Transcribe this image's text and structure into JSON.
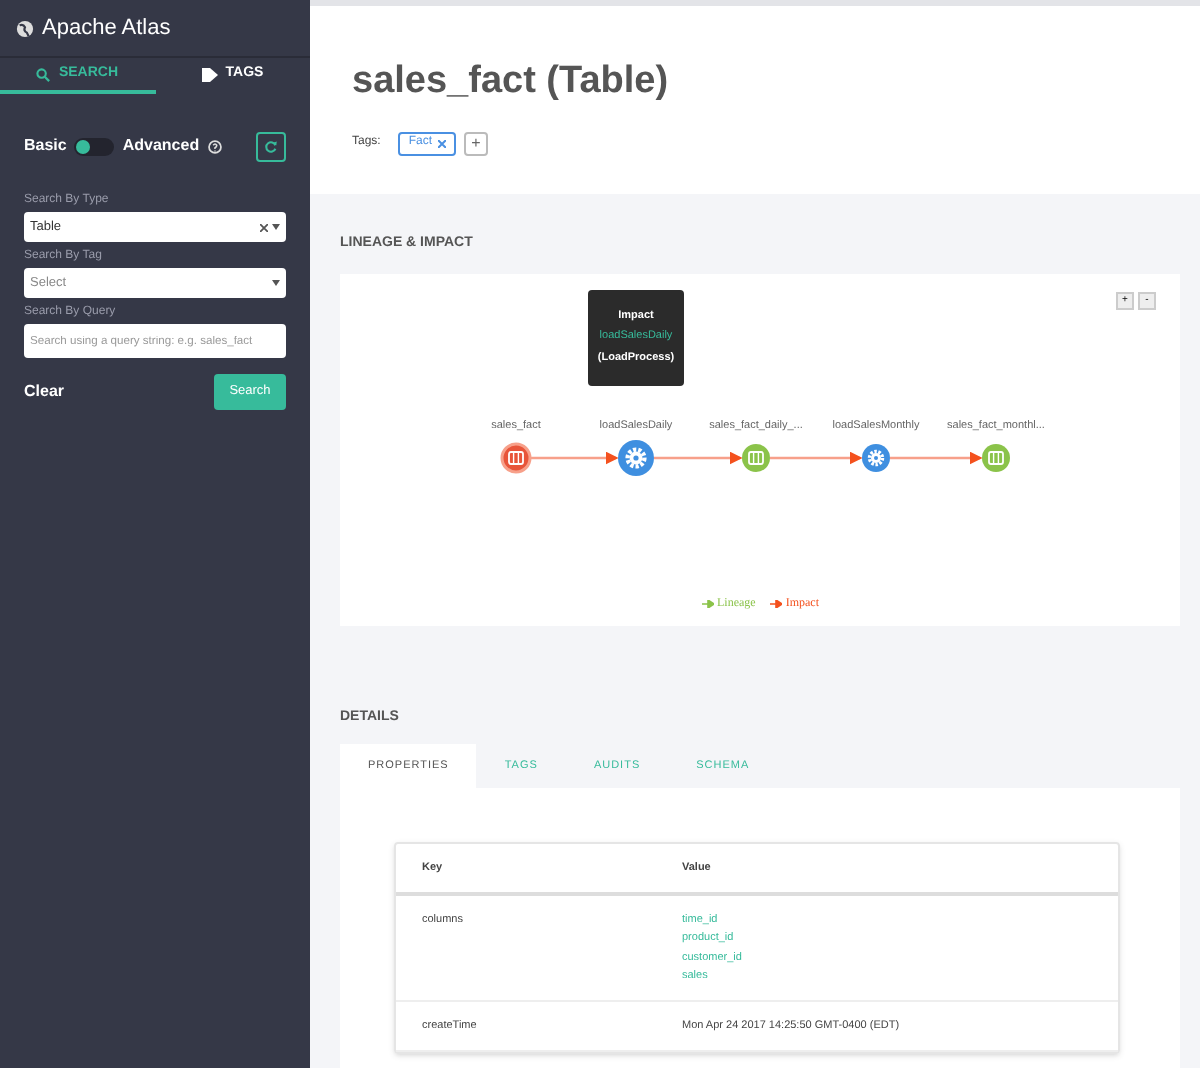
{
  "sidebar": {
    "title": "Apache Atlas",
    "tabs": [
      {
        "label": "SEARCH",
        "selected": true
      },
      {
        "label": "TAGS",
        "selected": false
      }
    ],
    "mode": {
      "basic_label": "Basic",
      "advanced_label": "Advanced",
      "advanced": false
    },
    "fields": [
      {
        "label": "Search By Type",
        "kind": "select",
        "value": "Table",
        "clearable": true
      },
      {
        "label": "Search By Tag",
        "kind": "select",
        "placeholder": "Select",
        "clearable": false
      },
      {
        "label": "Search By Query",
        "kind": "text",
        "placeholder": "Search using a query string: e.g. sales_fact"
      }
    ],
    "clear_label": "Clear",
    "search_label": "Search"
  },
  "entity": {
    "title": "sales_fact (Table)",
    "tags_label": "Tags:",
    "tags": [
      "Fact"
    ],
    "add_tag": "+"
  },
  "lineage": {
    "heading": "LINEAGE & IMPACT",
    "zoom_in": "+",
    "zoom_out": "-",
    "nodes": [
      {
        "label": "sales_fact",
        "kind": "table",
        "color": "#e8553a",
        "selected": true
      },
      {
        "label": "loadSalesDaily",
        "kind": "process",
        "color": "#3f8fe0",
        "selected": false,
        "tooltip": {
          "title": "Impact",
          "name": "loadSalesDaily",
          "type": "(LoadProcess)"
        }
      },
      {
        "label": "sales_fact_daily_...",
        "kind": "table",
        "color": "#8bc34a",
        "selected": false
      },
      {
        "label": "loadSalesMonthly",
        "kind": "process",
        "color": "#3f8fe0",
        "selected": false
      },
      {
        "label": "sales_fact_monthl...",
        "kind": "table",
        "color": "#8bc34a",
        "selected": false
      }
    ],
    "legend": [
      {
        "label": "Lineage",
        "color": "#8bc34a"
      },
      {
        "label": "Impact",
        "color": "#f4511e"
      }
    ]
  },
  "details": {
    "heading": "DETAILS",
    "tabs": [
      {
        "label": "PROPERTIES",
        "selected": true
      },
      {
        "label": "TAGS",
        "selected": false
      },
      {
        "label": "AUDITS",
        "selected": false
      },
      {
        "label": "SCHEMA",
        "selected": false
      }
    ],
    "columns": [
      "Key",
      "Value"
    ],
    "rows": [
      {
        "key": "columns",
        "values": [
          "time_id",
          "product_id",
          "customer_id",
          "sales"
        ],
        "kind": "links"
      },
      {
        "key": "createTime",
        "values": [
          "Mon Apr 24 2017 14:25:50 GMT-0400 (EDT)"
        ],
        "kind": "text"
      }
    ]
  }
}
